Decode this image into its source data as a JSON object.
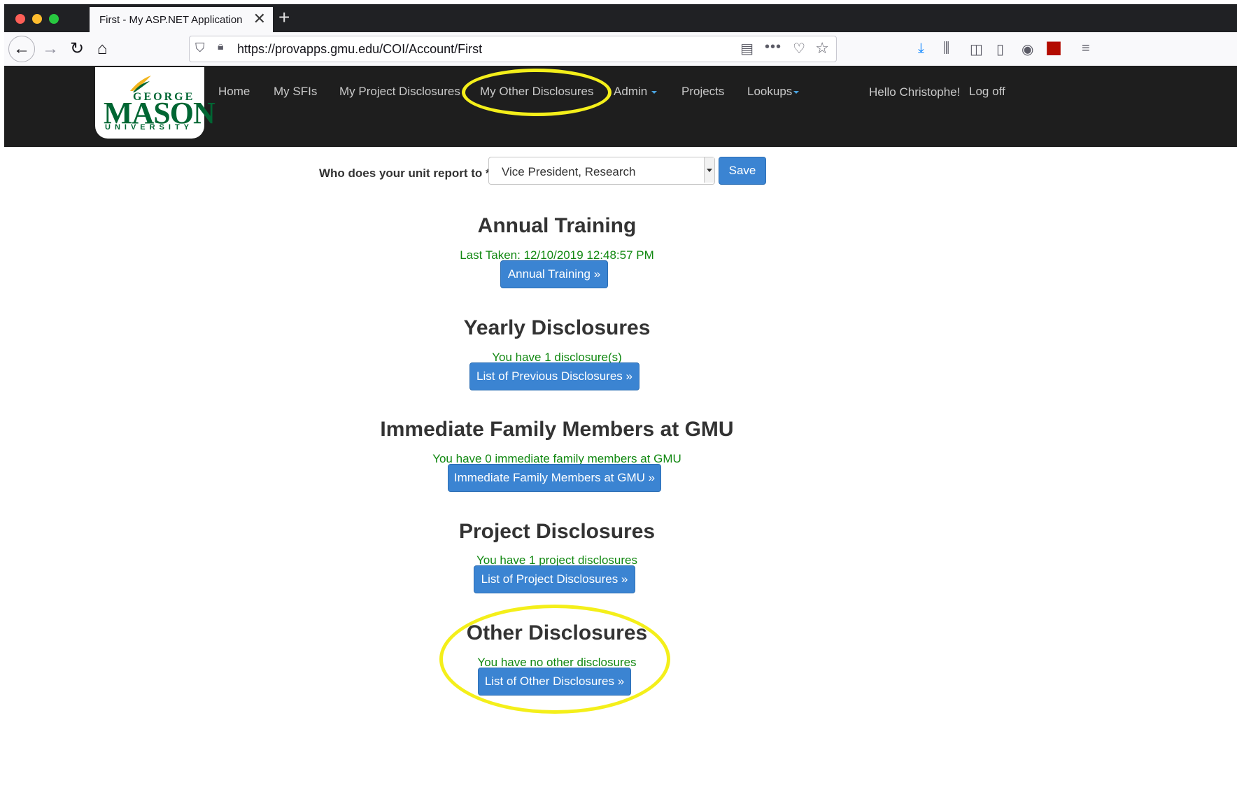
{
  "browser": {
    "tab_title": "First - My ASP.NET Application",
    "url": "https://provapps.gmu.edu/COI/Account/First"
  },
  "site": {
    "logo_line1": "GEORGE",
    "logo_line2": "MASON",
    "logo_line3": "UNIVERSITY",
    "nav": {
      "home": "Home",
      "sfis": "My SFIs",
      "project_disclosures": "My Project Disclosures",
      "other_disclosures": "My Other Disclosures",
      "admin": "Admin",
      "projects": "Projects",
      "lookups": "Lookups",
      "greeting": "Hello Christophe!",
      "logoff": "Log off"
    }
  },
  "report": {
    "label": "Who does your unit report to *:",
    "selected": "Vice President, Research",
    "save": "Save"
  },
  "sections": [
    {
      "title": "Annual Training",
      "status": "Last Taken: 12/10/2019 12:48:57 PM",
      "button": "Annual Training »"
    },
    {
      "title": "Yearly Disclosures",
      "status": "You have 1 disclosure(s)",
      "button": "List of Previous Disclosures »"
    },
    {
      "title": "Immediate Family Members at GMU",
      "status": "You have 0 immediate family members at GMU",
      "button": "Immediate Family Members at GMU »"
    },
    {
      "title": "Project Disclosures",
      "status": "You have 1 project disclosures",
      "button": "List of Project Disclosures »"
    },
    {
      "title": "Other Disclosures",
      "status": "You have no other disclosures",
      "button": "List of Other Disclosures »"
    }
  ],
  "colors": {
    "button_blue": "#3b84d2",
    "status_green": "#118811",
    "highlight_yellow": "#f4ef1a",
    "header_dark": "#1e1e1e",
    "gmu_green": "#006633"
  },
  "icons": [
    "back-icon",
    "forward-icon",
    "reload-icon",
    "home-icon",
    "shield-icon",
    "lock-icon",
    "reader-view-icon",
    "more-icon",
    "pocket-icon",
    "bookmark-star-icon",
    "download-icon",
    "library-icon",
    "sidebar-icon",
    "document-icon",
    "account-icon",
    "pdf-icon",
    "menu-icon"
  ]
}
